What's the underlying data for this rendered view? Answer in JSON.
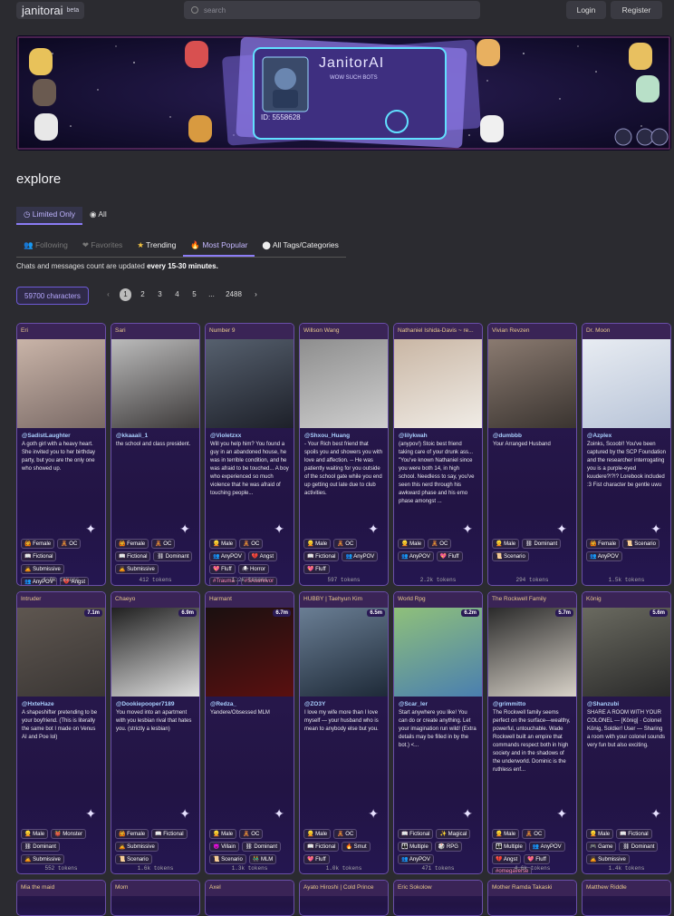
{
  "app": {
    "logo": "janitorai",
    "beta": "beta"
  },
  "search": {
    "placeholder": "search"
  },
  "auth": {
    "login": "Login",
    "register": "Register"
  },
  "banner": {
    "title": "JanitorAI",
    "subtitle": "WOW SUCH BOTS",
    "id": "ID: 5558628"
  },
  "page": {
    "title": "explore"
  },
  "view_tabs": [
    {
      "label": "Limited Only"
    },
    {
      "label": "All"
    }
  ],
  "category_tabs": [
    {
      "label": "Following"
    },
    {
      "label": "Favorites"
    },
    {
      "label": "Trending"
    },
    {
      "label": "Most Popular"
    },
    {
      "label": "All Tags/Categories"
    }
  ],
  "note": {
    "text": "Chats and messages count are updated ",
    "bold": "every 15-30 minutes."
  },
  "count": {
    "label": "59700 characters"
  },
  "pagination": {
    "pages": [
      "1",
      "2",
      "3",
      "4",
      "5",
      "...",
      "2488"
    ],
    "current": "1"
  },
  "cards": [
    {
      "name": "Eri",
      "author": "@SadistLaughter",
      "desc": "A goth girl with a heavy heart. She invited you to her birthday party, but you are the only one who showed up.",
      "tags": [
        "Female",
        "OC",
        "Fictional",
        "Submissive",
        "AnyPOV",
        "Angst",
        "Fluff"
      ],
      "tokens": "1.9k tokens",
      "stat": "",
      "colors": [
        "#7a6a66",
        "#c9b4a8"
      ]
    },
    {
      "name": "Sari",
      "author": "@kkaaaii_1",
      "desc": "the school and class president.",
      "tags": [
        "Female",
        "OC",
        "Fictional",
        "Dominant",
        "Submissive"
      ],
      "tokens": "412 tokens",
      "stat": "",
      "colors": [
        "#3d3a3a",
        "#bbb"
      ]
    },
    {
      "name": "Number 9",
      "author": "@Violetzxx",
      "desc": "Will you help him? You found a guy in an abandoned house, he was in terrible condition, and he was afraid to be touched... A boy who experienced so much violence that he was afraid of touching people...",
      "tags": [
        "Male",
        "OC",
        "AnyPOV",
        "Angst",
        "Fluff",
        "Horror",
        "#Trauma",
        "#SAsurvivor",
        "#Depression",
        "#Anxiety"
      ],
      "tokens": "1.2k tokens",
      "stat": "",
      "colors": [
        "#1d2029",
        "#56606e"
      ]
    },
    {
      "name": "Willson Wang",
      "author": "@Shxou_Huang",
      "desc": "- Your Rich best friend that spoils you and showers you with love and affection. -- He was patiently waiting for you outside of the school gate while you end up getting out late due to club activities.",
      "tags": [
        "Male",
        "OC",
        "Fictional",
        "AnyPOV",
        "Fluff"
      ],
      "tokens": "597 tokens",
      "stat": "",
      "colors": [
        "#cfcfcf",
        "#8e8e8e"
      ]
    },
    {
      "name": "Nathaniel Ishida-Davis ~ re...",
      "author": "@lilykwah",
      "desc": "(anypov!) Stoic best friend taking care of your drunk ass... \"You've known Nathaniel since you were both 14, in high school. Needless to say, you've seen this nerd through his awkward phase and his emo phase amongst ...",
      "tags": [
        "Male",
        "OC",
        "AnyPOV",
        "Fluff"
      ],
      "tokens": "2.2k tokens",
      "stat": "",
      "colors": [
        "#f0ece6",
        "#c9b6a4"
      ]
    },
    {
      "name": "Vivian Revzen",
      "author": "@dumbbb",
      "desc": "Your Arranged Husband",
      "tags": [
        "Male",
        "Dominant",
        "Scenario"
      ],
      "tokens": "294 tokens",
      "stat": "",
      "colors": [
        "#3a3430",
        "#8a7a70"
      ]
    },
    {
      "name": "Dr. Moon",
      "author": "@Azplex",
      "desc": "Zoinks, Scoob!! You've been captured by the SCP Foundation and the researcher interrogating you is a purple-eyed kuudere?!?!? Lorebook included :3 Fist character be gentle uwu",
      "tags": [
        "Female",
        "Scenario",
        "AnyPOV"
      ],
      "tokens": "1.5k tokens",
      "stat": "",
      "colors": [
        "#b8c4d8",
        "#e8ecf2"
      ]
    },
    {
      "name": "Intruder",
      "author": "@HxteHaze",
      "desc": "A shapeshifter pretending to be your boyfriend. (This is literally the same bot I made on Venus AI and Poe lol)",
      "tags": [
        "Male",
        "Monster",
        "Dominant",
        "Submissive"
      ],
      "tokens": "552 tokens",
      "stat": "7.1m",
      "colors": [
        "#3a3634",
        "#5e5650"
      ]
    },
    {
      "name": "Chaeyo",
      "author": "@Dookiepooper7189",
      "desc": "You moved into an apartment with you lesbian rival that hates you. (strictly a lesbian)",
      "tags": [
        "Female",
        "Fictional",
        "Submissive",
        "Scenario"
      ],
      "tokens": "1.6k tokens",
      "stat": "6.9m",
      "colors": [
        "#e0e0e0",
        "#202020"
      ]
    },
    {
      "name": "Harmant",
      "author": "@Redza_",
      "desc": "Yandere/Obsessed MLM",
      "tags": [
        "Male",
        "OC",
        "Villain",
        "Dominant",
        "Scenario",
        "MLM"
      ],
      "tokens": "1.3k tokens",
      "stat": "6.7m",
      "colors": [
        "#5a1010",
        "#1a1010"
      ]
    },
    {
      "name": "HUBBY | Taehyun Kim",
      "author": "@ZO3Y",
      "desc": "I love my wife more than I love myself — your husband who is mean to anybody else but you.",
      "tags": [
        "Male",
        "OC",
        "Fictional",
        "Smut",
        "Fluff"
      ],
      "tokens": "1.0k tokens",
      "stat": "6.5m",
      "colors": [
        "#1e2a38",
        "#6a7e94"
      ]
    },
    {
      "name": "World Rpg",
      "author": "@Scar_ler",
      "desc": "Start anywhere you like! You can do or create anything. Let your imagination run wild! (Extra details may be filled in by the bot.) <...",
      "tags": [
        "Fictional",
        "Magical",
        "Multiple",
        "RPG",
        "AnyPOV"
      ],
      "tokens": "471 tokens",
      "stat": "6.2m",
      "colors": [
        "#4a7fb0",
        "#8fc07a"
      ]
    },
    {
      "name": "The Rockwell Family",
      "author": "@grimmitto",
      "desc": "The Rockwell family seems perfect on the surface—wealthy, powerful, untouchable. Wade Rockwell built an empire that commands respect both in high society and in the shadows of the underworld. Dominic is the ruthless enf...",
      "tags": [
        "Male",
        "OC",
        "Multiple",
        "AnyPOV",
        "Angst",
        "Fluff",
        "#omegaverse",
        "#OmegaUser",
        "#RockwellSeries"
      ],
      "tokens": "4.6k tokens",
      "stat": "5.7m",
      "colors": [
        "#d8d2c8",
        "#2a2a2a"
      ]
    },
    {
      "name": "König",
      "author": "@Shanzubi",
      "desc": "SHARE A ROOM WITH YOUR COLONEL — [König] · Colonel König, Soldier! User — Sharing a room with your colonel sounds very fun but also exciting.",
      "tags": [
        "Male",
        "Fictional",
        "Game",
        "Dominant",
        "Submissive"
      ],
      "tokens": "1.4k tokens",
      "stat": "5.6m",
      "colors": [
        "#2a2a2a",
        "#6a6a60"
      ]
    },
    {
      "name": "Mia the maid",
      "author": "",
      "desc": "",
      "tags": [],
      "tokens": "",
      "stat": "",
      "colors": [
        "#2b1b52",
        "#2b1b52"
      ]
    },
    {
      "name": "Mom",
      "author": "",
      "desc": "",
      "tags": [],
      "tokens": "",
      "stat": "",
      "colors": [
        "#2b1b52",
        "#2b1b52"
      ]
    },
    {
      "name": "Axel",
      "author": "",
      "desc": "",
      "tags": [],
      "tokens": "",
      "stat": "",
      "colors": [
        "#2b1b52",
        "#2b1b52"
      ]
    },
    {
      "name": "Ayato Hiroshi | Cold Prince",
      "author": "",
      "desc": "",
      "tags": [],
      "tokens": "",
      "stat": "",
      "colors": [
        "#2b1b52",
        "#2b1b52"
      ]
    },
    {
      "name": "Eric Sokolow",
      "author": "",
      "desc": "",
      "tags": [],
      "tokens": "",
      "stat": "",
      "colors": [
        "#2b1b52",
        "#2b1b52"
      ]
    },
    {
      "name": "Mother Ramda Takaski",
      "author": "",
      "desc": "",
      "tags": [],
      "tokens": "",
      "stat": "",
      "colors": [
        "#2b1b52",
        "#2b1b52"
      ]
    },
    {
      "name": "Matthew Riddle",
      "author": "",
      "desc": "",
      "tags": [],
      "tokens": "",
      "stat": "",
      "colors": [
        "#2b1b52",
        "#2b1b52"
      ]
    }
  ]
}
